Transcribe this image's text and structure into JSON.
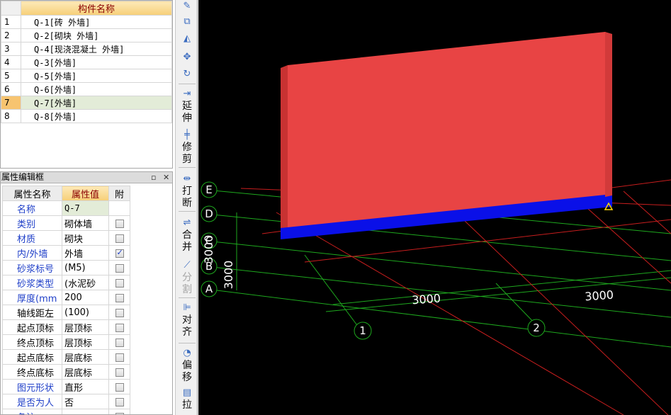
{
  "component_list": {
    "header": "构件名称",
    "rows": [
      {
        "idx": "1",
        "name": "Q-1[砖 外墙]"
      },
      {
        "idx": "2",
        "name": "Q-2[砌块 外墙]"
      },
      {
        "idx": "3",
        "name": "Q-4[现浇混凝土 外墙]"
      },
      {
        "idx": "4",
        "name": "Q-3[外墙]"
      },
      {
        "idx": "5",
        "name": "Q-5[外墙]"
      },
      {
        "idx": "6",
        "name": "Q-6[外墙]"
      },
      {
        "idx": "7",
        "name": "Q-7[外墙]"
      },
      {
        "idx": "8",
        "name": "Q-8[外墙]"
      }
    ],
    "selected_index": 6
  },
  "property_panel": {
    "title": "属性编辑框",
    "pin_icon": "pin-icon",
    "close_icon": "close-icon",
    "col_name": "属性名称",
    "col_value": "属性值",
    "col_attach": "附",
    "rows": [
      {
        "name": "名称",
        "value": "Q-7",
        "checkbox": "none",
        "color": "blue"
      },
      {
        "name": "类别",
        "value": "砌体墙",
        "checkbox": "unchecked",
        "color": "blue"
      },
      {
        "name": "材质",
        "value": "砌块",
        "checkbox": "unchecked",
        "color": "blue"
      },
      {
        "name": "内/外墙",
        "value": "外墙",
        "checkbox": "checked",
        "color": "blue"
      },
      {
        "name": "砂浆标号",
        "value": "(M5)",
        "checkbox": "unchecked",
        "color": "blue"
      },
      {
        "name": "砂浆类型",
        "value": "(水泥砂",
        "checkbox": "unchecked",
        "color": "blue"
      },
      {
        "name": "厚度(mm",
        "value": "200",
        "checkbox": "unchecked",
        "color": "blue"
      },
      {
        "name": "轴线距左",
        "value": "(100)",
        "checkbox": "unchecked",
        "color": "black"
      },
      {
        "name": "起点顶标",
        "value": "层顶标",
        "checkbox": "unchecked",
        "color": "black"
      },
      {
        "name": "终点顶标",
        "value": "层顶标",
        "checkbox": "unchecked",
        "color": "black"
      },
      {
        "name": "起点底标",
        "value": "层底标",
        "checkbox": "unchecked",
        "color": "black"
      },
      {
        "name": "终点底标",
        "value": "层底标",
        "checkbox": "unchecked",
        "color": "black"
      },
      {
        "name": "图元形状",
        "value": "直形",
        "checkbox": "unchecked",
        "color": "blue"
      },
      {
        "name": "是否为人",
        "value": "否",
        "checkbox": "unchecked",
        "color": "blue"
      },
      {
        "name": "备注",
        "value": "",
        "checkbox": "unchecked",
        "color": "blue"
      }
    ]
  },
  "toolbar": {
    "buttons": [
      {
        "id": "pen",
        "icon": "pen-icon",
        "label": ""
      },
      {
        "id": "copy",
        "icon": "copy-icon",
        "label": ""
      },
      {
        "id": "mirror",
        "icon": "mirror-icon",
        "label": ""
      },
      {
        "id": "move",
        "icon": "move-icon",
        "label": ""
      },
      {
        "id": "rotate",
        "icon": "rotate-icon",
        "label": ""
      },
      {
        "id": "extend",
        "icon": "extend-icon",
        "label": "延伸"
      },
      {
        "id": "trim",
        "icon": "trim-icon",
        "label": "修剪"
      },
      {
        "id": "break",
        "icon": "break-icon",
        "label": "打断"
      },
      {
        "id": "merge",
        "icon": "merge-icon",
        "label": "合并"
      },
      {
        "id": "split",
        "icon": "split-icon",
        "label": "分割"
      },
      {
        "id": "align",
        "icon": "align-icon",
        "label": "对齐"
      },
      {
        "id": "offset",
        "icon": "offset-icon",
        "label": "偏移"
      },
      {
        "id": "stretch",
        "icon": "stretch-icon",
        "label": "拉"
      }
    ]
  },
  "viewport": {
    "axis_labels_rows": [
      "E",
      "D",
      "C",
      "B",
      "A"
    ],
    "axis_labels_cols": [
      "1",
      "2"
    ],
    "dimensions": [
      "3000",
      "3000",
      "3000",
      "3000"
    ],
    "colors": {
      "background": "#000000",
      "wall_face": "#e84444",
      "wall_side": "#c83232",
      "wall_base": "#0a10e8",
      "grid_red": "#c81e1e",
      "grid_green": "#1ea81e",
      "marker": "#ffd800"
    }
  }
}
